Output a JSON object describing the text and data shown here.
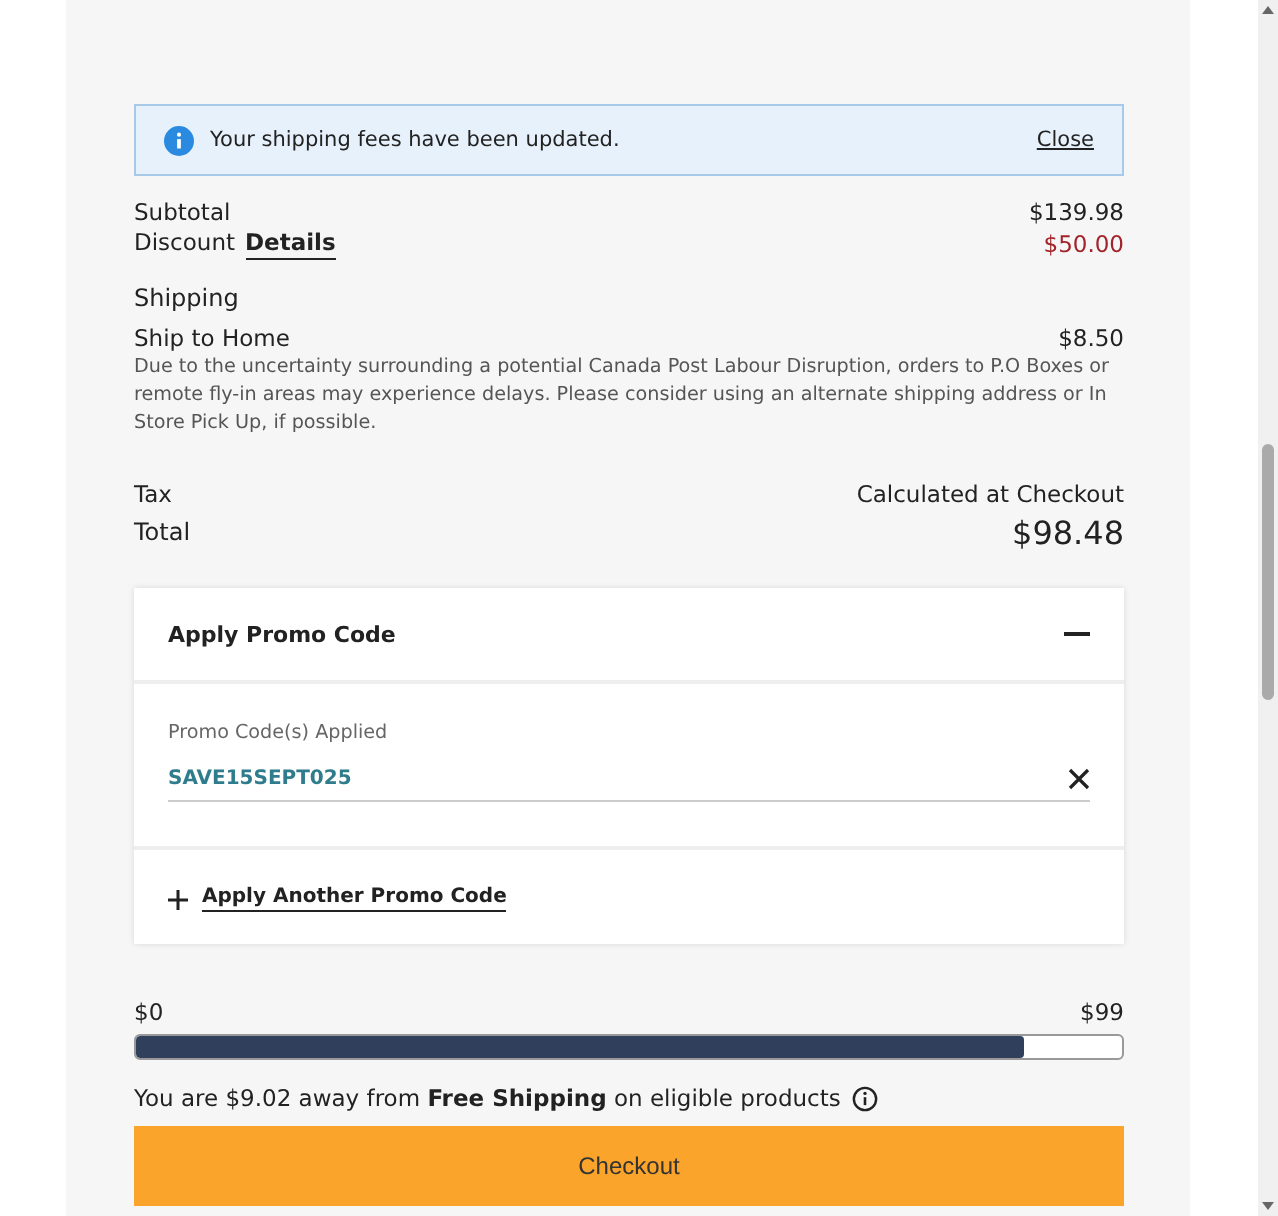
{
  "notice": {
    "message": "Your shipping fees have been updated.",
    "close": "Close"
  },
  "summary": {
    "subtotal_label": "Subtotal",
    "subtotal": "$139.98",
    "discount_label": "Discount",
    "discount_link": "Details",
    "discount": "$50.00"
  },
  "shipping": {
    "heading": "Shipping",
    "method": "Ship to Home",
    "price": "$8.50",
    "note": "Due to the uncertainty surrounding a potential Canada Post Labour Disruption, orders to P.O Boxes or remote fly-in areas may experience delays. Please consider using an alternate shipping address or In Store Pick Up, if possible."
  },
  "tax": {
    "label": "Tax",
    "value": "Calculated at Checkout"
  },
  "total": {
    "label": "Total",
    "value": "$98.48"
  },
  "promo": {
    "title": "Apply Promo Code",
    "expanded": true,
    "applied_label": "Promo Code(s) Applied",
    "codes": [
      "SAVE15SEPT025"
    ],
    "add_link": "Apply Another Promo Code"
  },
  "free_shipping": {
    "min": "$0",
    "max": "$99",
    "level": 0.9,
    "message": "You are $9.02 away from **Free Shipping** on eligible products"
  },
  "checkout": "Checkout"
}
